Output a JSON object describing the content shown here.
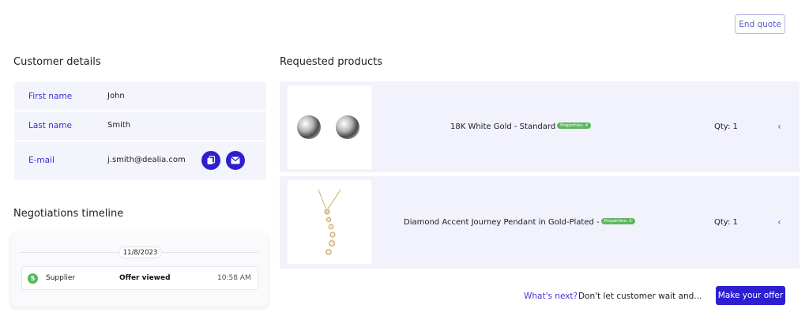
{
  "header": {
    "end_quote_label": "End quote"
  },
  "customer": {
    "title": "Customer details",
    "fields": [
      {
        "label": "First name",
        "value": "John"
      },
      {
        "label": "Last name",
        "value": "Smith"
      },
      {
        "label": "E-mail",
        "value": "j.smith@dealia.com"
      }
    ],
    "icons": [
      "copy-icon",
      "mail-icon"
    ]
  },
  "timeline": {
    "title": "Negotiations timeline",
    "date": "11/8/2023",
    "entries": [
      {
        "badge": "S",
        "actor": "Supplier",
        "action": "Offer viewed",
        "time": "10:58 AM"
      }
    ]
  },
  "products": {
    "title": "Requested products",
    "items": [
      {
        "name": "18K White Gold - Standard",
        "properties": "Properties: 4",
        "qty": "Qty: 1"
      },
      {
        "name": "Diamond Accent Journey Pendant in Gold-Plated -",
        "properties": "Properties: 3",
        "qty": "Qty: 1"
      }
    ]
  },
  "footer": {
    "whats_next": "What's next?",
    "hint": "Don't let customer wait and...",
    "make_offer_label": "Make your offer"
  },
  "colors": {
    "accent": "#2d1fd0",
    "badge_green": "#5fb65e",
    "row_bg": "#f2f2fd"
  }
}
